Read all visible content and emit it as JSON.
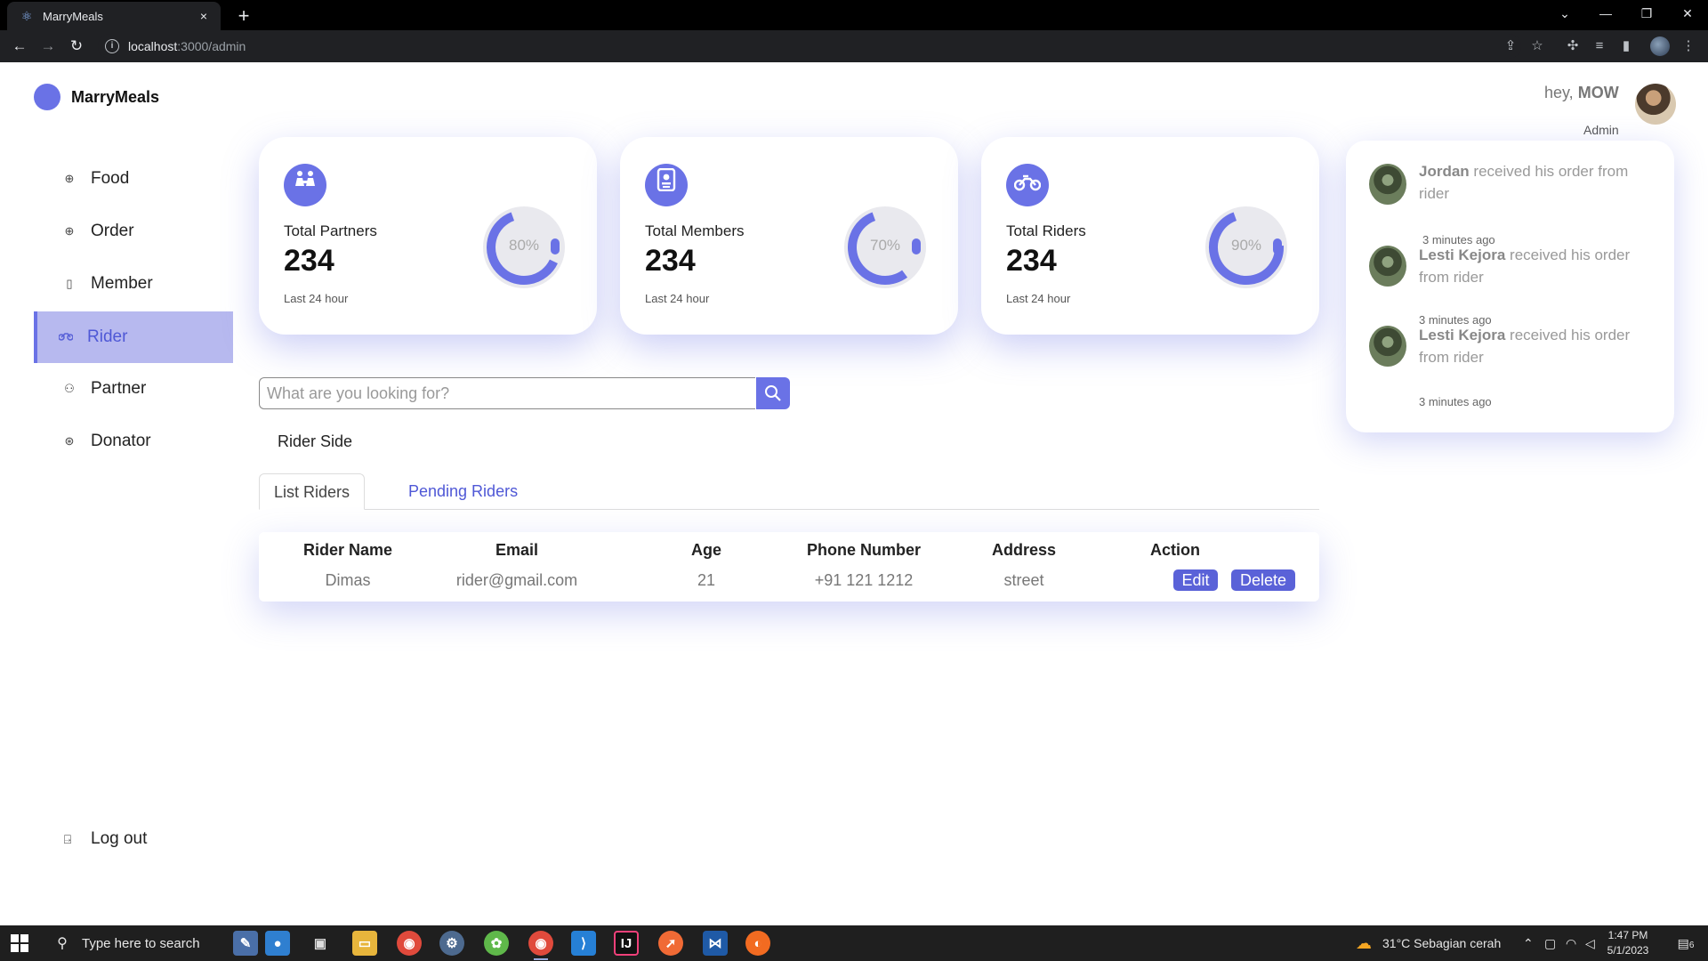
{
  "browser": {
    "tab_title": "MarryMeals",
    "tab_close": "×",
    "new_tab": "+",
    "url_host": "localhost",
    "url_path": ":3000/admin",
    "window_controls": [
      "⌄",
      "—",
      "❐",
      "✕"
    ]
  },
  "brand": {
    "name": "MarryMeals"
  },
  "sidebar": {
    "items": [
      {
        "label": "Food",
        "icon": "plus-circle-icon",
        "glyph": "⊕"
      },
      {
        "label": "Order",
        "icon": "plus-circle-icon",
        "glyph": "⊕"
      },
      {
        "label": "Member",
        "icon": "id-card-icon",
        "glyph": "▯"
      },
      {
        "label": "Rider",
        "icon": "motorcycle-icon",
        "glyph": "⚲",
        "active": true
      },
      {
        "label": "Partner",
        "icon": "people-icon",
        "glyph": "⚇"
      },
      {
        "label": "Donator",
        "icon": "donate-icon",
        "glyph": "⊛"
      }
    ],
    "logout_label": "Log out"
  },
  "header": {
    "greeting_prefix": "hey,",
    "user_name": "MOW",
    "role": "Admin"
  },
  "stats": [
    {
      "label": "Total Partners",
      "value": "234",
      "sub": "Last 24 hour",
      "percent_text": "80%",
      "percent": 80,
      "icon": "partners-icon"
    },
    {
      "label": "Total Members",
      "value": "234",
      "sub": "Last 24 hour",
      "percent_text": "70%",
      "percent": 70,
      "icon": "member-card-icon"
    },
    {
      "label": "Total Riders",
      "value": "234",
      "sub": "Last 24 hour",
      "percent_text": "90%",
      "percent": 90,
      "icon": "motorcycle-icon"
    }
  ],
  "search": {
    "placeholder": "What are you looking for?"
  },
  "rider_section": {
    "title": "Rider Side",
    "tabs": [
      "List Riders",
      "Pending Riders"
    ],
    "columns": [
      "Rider Name",
      "Email",
      "Age",
      "Phone Number",
      "Address",
      "Action"
    ],
    "rows": [
      {
        "name": "Dimas",
        "email": "rider@gmail.com",
        "age": "21",
        "phone": "+91 121 1212",
        "address": "street"
      }
    ],
    "edit_label": "Edit",
    "delete_label": "Delete"
  },
  "notifications": [
    {
      "name": "Jordan",
      "text": "received his order from rider",
      "time": "3 minutes ago"
    },
    {
      "name": "Lesti Kejora",
      "text": "received his order from rider",
      "time": "3 minutes ago"
    },
    {
      "name": "Lesti Kejora",
      "text": "received his order from rider",
      "time": "3 minutes ago"
    }
  ],
  "taskbar": {
    "search_placeholder": "Type here to search",
    "weather": "31°C  Sebagian cerah",
    "time": "1:47 PM",
    "date": "5/1/2023",
    "notification_count": "6"
  },
  "colors": {
    "accent": "#6a72e6",
    "active_bg": "#b7b9ef",
    "donut_track": "#e9e9ee"
  }
}
